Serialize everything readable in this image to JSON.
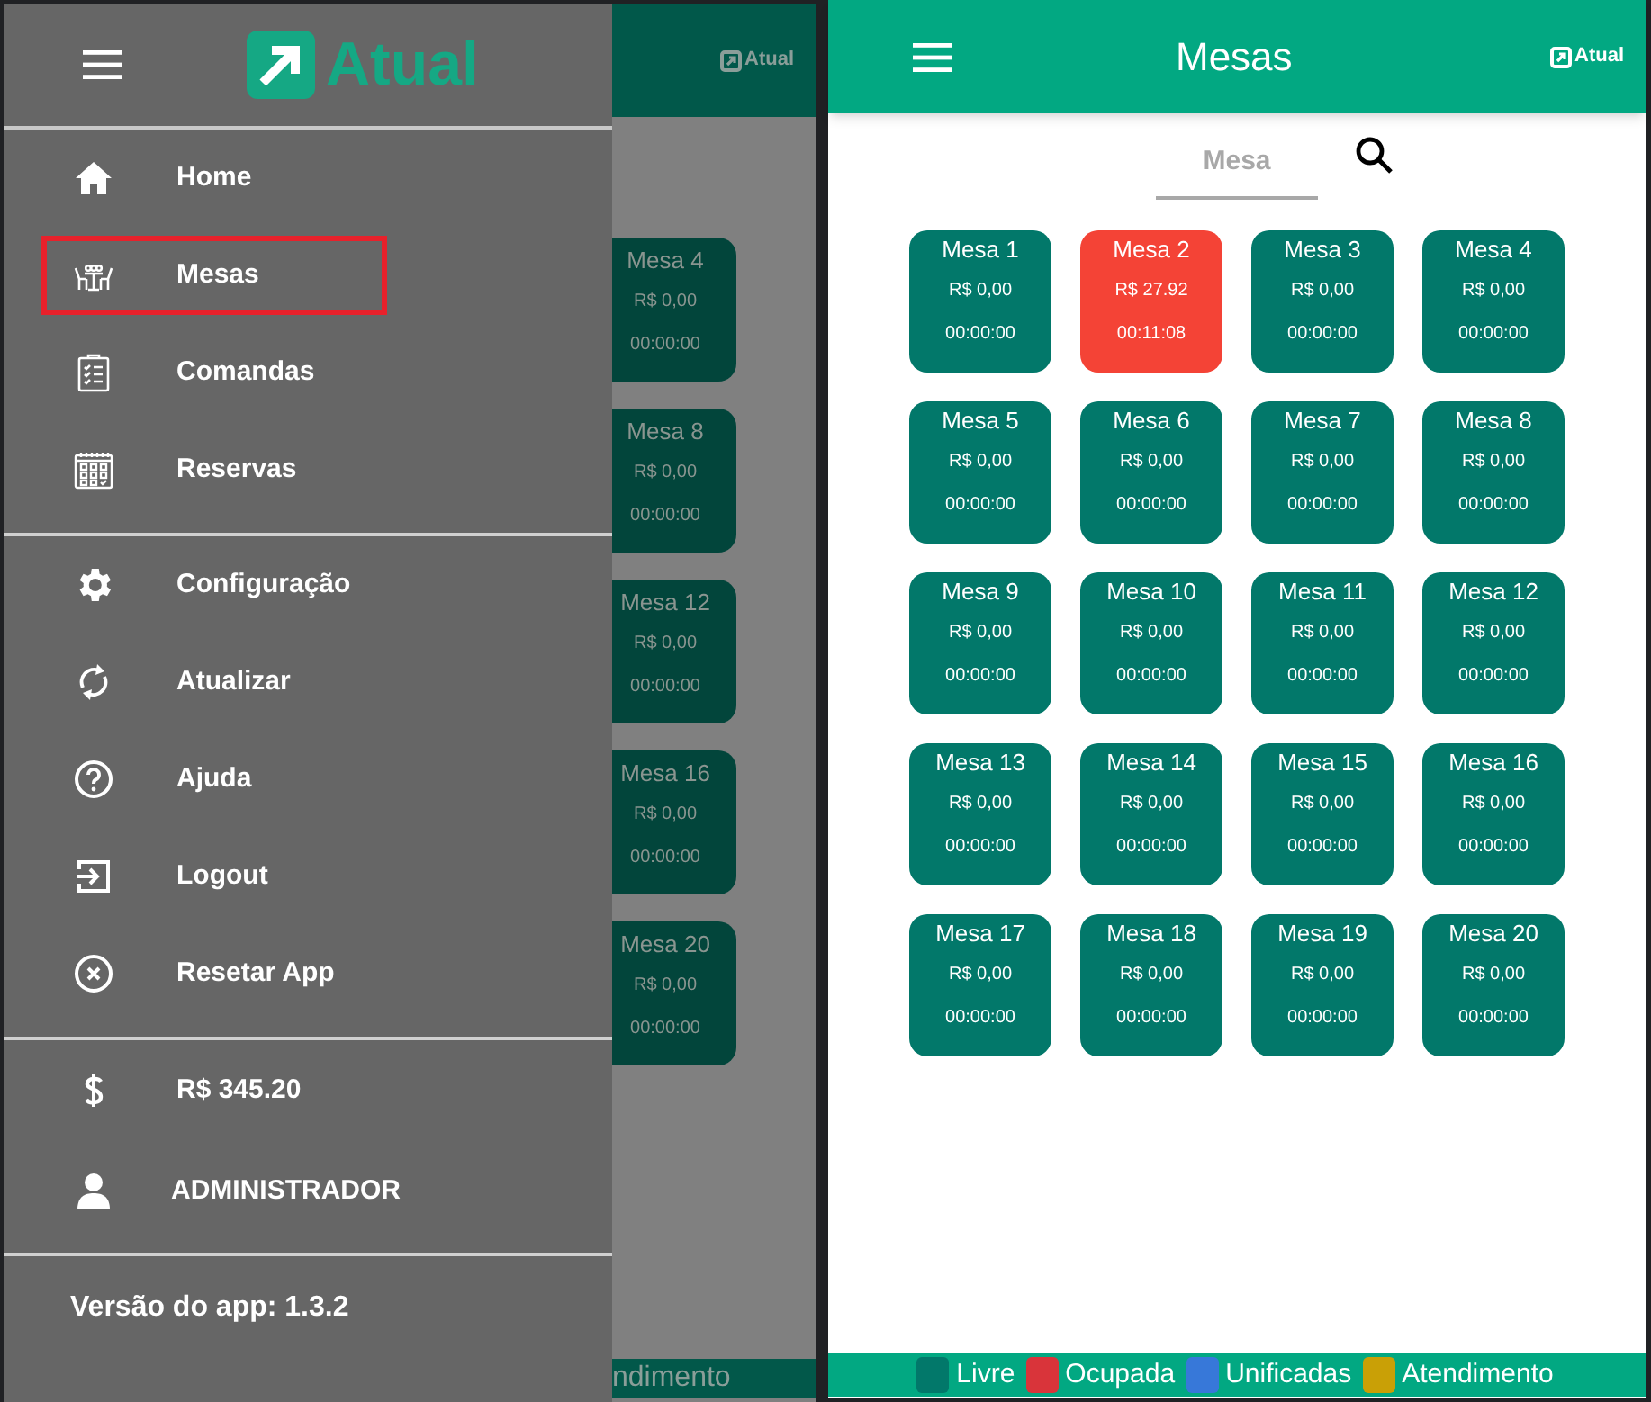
{
  "left_screen": {
    "background_app": {
      "header": {
        "logo": "Atual"
      },
      "tables": [
        {
          "name": "Mesa 4",
          "amount": "R$ 0,00",
          "time": "00:00:00"
        },
        {
          "name": "Mesa 8",
          "amount": "R$ 0,00",
          "time": "00:00:00"
        },
        {
          "name": "Mesa 12",
          "amount": "R$ 0,00",
          "time": "00:00:00"
        },
        {
          "name": "Mesa 16",
          "amount": "R$ 0,00",
          "time": "00:00:00"
        },
        {
          "name": "Mesa 20",
          "amount": "R$ 0,00",
          "time": "00:00:00"
        }
      ],
      "legend_text": "ndimento"
    },
    "drawer": {
      "logo": "Atual",
      "menu_groups": [
        [
          {
            "kind": "home",
            "label": "Home",
            "selected": false
          },
          {
            "kind": "tables",
            "label": "Mesas",
            "selected": true
          },
          {
            "kind": "clipboard",
            "label": "Comandas",
            "selected": false
          },
          {
            "kind": "calendar",
            "label": "Reservas",
            "selected": false
          }
        ],
        [
          {
            "kind": "gear",
            "label": "Configuração",
            "selected": false
          },
          {
            "kind": "sync",
            "label": "Atualizar",
            "selected": false
          },
          {
            "kind": "help",
            "label": "Ajuda",
            "selected": false
          },
          {
            "kind": "logout",
            "label": "Logout",
            "selected": false
          },
          {
            "kind": "reset",
            "label": "Resetar App",
            "selected": false
          }
        ]
      ],
      "info": [
        {
          "kind": "money",
          "label": "R$ 345.20"
        },
        {
          "kind": "user",
          "label": "ADMINISTRADOR"
        }
      ],
      "versions": [
        "Versão do app: 1.3.2"
      ]
    }
  },
  "right_screen": {
    "header": {
      "title": "Mesas",
      "logo": "Atual"
    },
    "search": {
      "placeholder": "Mesa"
    },
    "tables": [
      {
        "name": "Mesa 1",
        "amount": "R$ 0,00",
        "time": "00:00:00",
        "color": "#02786a"
      },
      {
        "name": "Mesa 2",
        "amount": "R$ 27.92",
        "time": "00:11:08",
        "color": "#f44336"
      },
      {
        "name": "Mesa 3",
        "amount": "R$ 0,00",
        "time": "00:00:00",
        "color": "#02786a"
      },
      {
        "name": "Mesa 4",
        "amount": "R$ 0,00",
        "time": "00:00:00",
        "color": "#02786a"
      },
      {
        "name": "Mesa 5",
        "amount": "R$ 0,00",
        "time": "00:00:00",
        "color": "#02786a"
      },
      {
        "name": "Mesa 6",
        "amount": "R$ 0,00",
        "time": "00:00:00",
        "color": "#02786a"
      },
      {
        "name": "Mesa 7",
        "amount": "R$ 0,00",
        "time": "00:00:00",
        "color": "#02786a"
      },
      {
        "name": "Mesa 8",
        "amount": "R$ 0,00",
        "time": "00:00:00",
        "color": "#02786a"
      },
      {
        "name": "Mesa 9",
        "amount": "R$ 0,00",
        "time": "00:00:00",
        "color": "#02786a"
      },
      {
        "name": "Mesa 10",
        "amount": "R$ 0,00",
        "time": "00:00:00",
        "color": "#02786a"
      },
      {
        "name": "Mesa 11",
        "amount": "R$ 0,00",
        "time": "00:00:00",
        "color": "#02786a"
      },
      {
        "name": "Mesa 12",
        "amount": "R$ 0,00",
        "time": "00:00:00",
        "color": "#02786a"
      },
      {
        "name": "Mesa 13",
        "amount": "R$ 0,00",
        "time": "00:00:00",
        "color": "#02786a"
      },
      {
        "name": "Mesa 14",
        "amount": "R$ 0,00",
        "time": "00:00:00",
        "color": "#02786a"
      },
      {
        "name": "Mesa 15",
        "amount": "R$ 0,00",
        "time": "00:00:00",
        "color": "#02786a"
      },
      {
        "name": "Mesa 16",
        "amount": "R$ 0,00",
        "time": "00:00:00",
        "color": "#02786a"
      },
      {
        "name": "Mesa 17",
        "amount": "R$ 0,00",
        "time": "00:00:00",
        "color": "#02786a"
      },
      {
        "name": "Mesa 18",
        "amount": "R$ 0,00",
        "time": "00:00:00",
        "color": "#02786a"
      },
      {
        "name": "Mesa 19",
        "amount": "R$ 0,00",
        "time": "00:00:00",
        "color": "#02786a"
      },
      {
        "name": "Mesa 20",
        "amount": "R$ 0,00",
        "time": "00:00:00",
        "color": "#02786a"
      }
    ],
    "legend": [
      {
        "label": "Livre",
        "color": "#02786a"
      },
      {
        "label": "Ocupada",
        "color": "#d9343a"
      },
      {
        "label": "Unificadas",
        "color": "#3778d9"
      },
      {
        "label": "Atendimento",
        "color": "#c9a006"
      }
    ]
  }
}
